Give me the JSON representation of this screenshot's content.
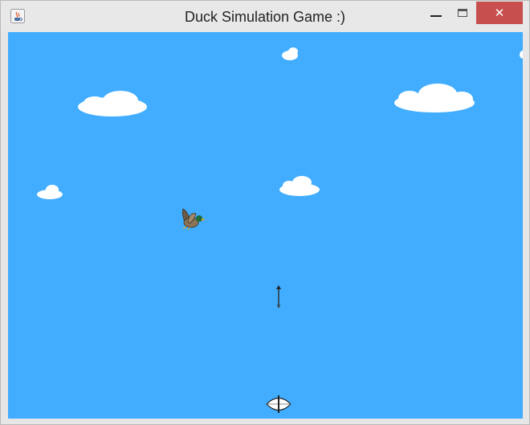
{
  "window": {
    "title": "Duck Simulation Game :)",
    "close_glyph": "✕"
  },
  "icons": {
    "app": "java-coffee-cup-icon",
    "minimize": "minimize-icon",
    "maximize": "maximize-icon",
    "close": "close-icon"
  },
  "colors": {
    "sky": "#42adfe",
    "cloud": "#ffffff",
    "close_button": "#c7504f",
    "titlebar": "#e8e8e8"
  },
  "game": {
    "sprites": [
      "clouds",
      "duck",
      "arrow",
      "bow"
    ]
  }
}
